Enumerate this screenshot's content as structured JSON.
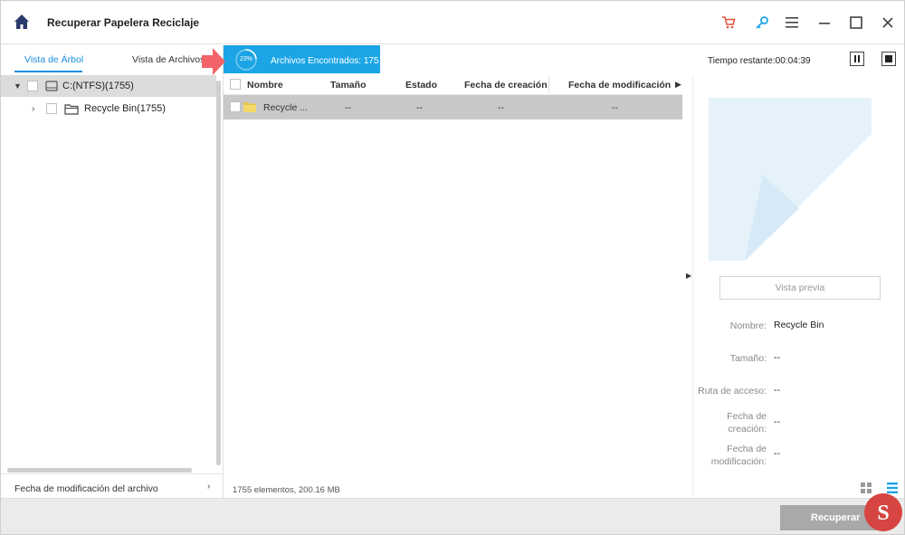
{
  "window": {
    "title": "Recuperar Papelera Reciclaje"
  },
  "left_panel": {
    "tabs": [
      {
        "label": "Vista de Árbol",
        "active": true
      },
      {
        "label": "Vista de Archivos",
        "active": false
      }
    ],
    "tree": [
      {
        "label": "C:(NTFS)(1755)",
        "expanded": true,
        "icon": "drive-icon"
      },
      {
        "label": "Recycle Bin(1755)",
        "expanded": false,
        "icon": "folder-outline-icon"
      }
    ],
    "sort_label": "Fecha de modificación del archivo"
  },
  "scan": {
    "progress_percent": 23,
    "progress_label": "23%",
    "found_label": "Archivos Encontrados: 175",
    "time_remaining": "Tiempo restante:00:04:39"
  },
  "table": {
    "columns": [
      "Nombre",
      "Tamaño",
      "Estado",
      "Fecha de creación",
      "Fecha de modificación"
    ],
    "rows": [
      {
        "name": "Recycle ...",
        "size": "--",
        "state": "--",
        "created": "--",
        "modified": "--"
      }
    ]
  },
  "status": {
    "summary": "1755 elementos, 200.16 MB"
  },
  "preview": {
    "button_label": "Vista previa",
    "fields": [
      {
        "label": "Nombre:",
        "value": "Recycle Bin"
      },
      {
        "label": "Tamaño:",
        "value": "--"
      },
      {
        "label": "Ruta de acceso:",
        "value": "--"
      },
      {
        "label": "Fecha de\ncreación:",
        "value": "--"
      },
      {
        "label": "Fecha de\nmodificación:",
        "value": "--"
      }
    ]
  },
  "footer": {
    "recover_label": "Recuperar"
  },
  "colors": {
    "accent": "#1ba5e6",
    "tab_active": "#1a8ee0",
    "cart": "#e8503a",
    "arrow": "#f4636a"
  }
}
